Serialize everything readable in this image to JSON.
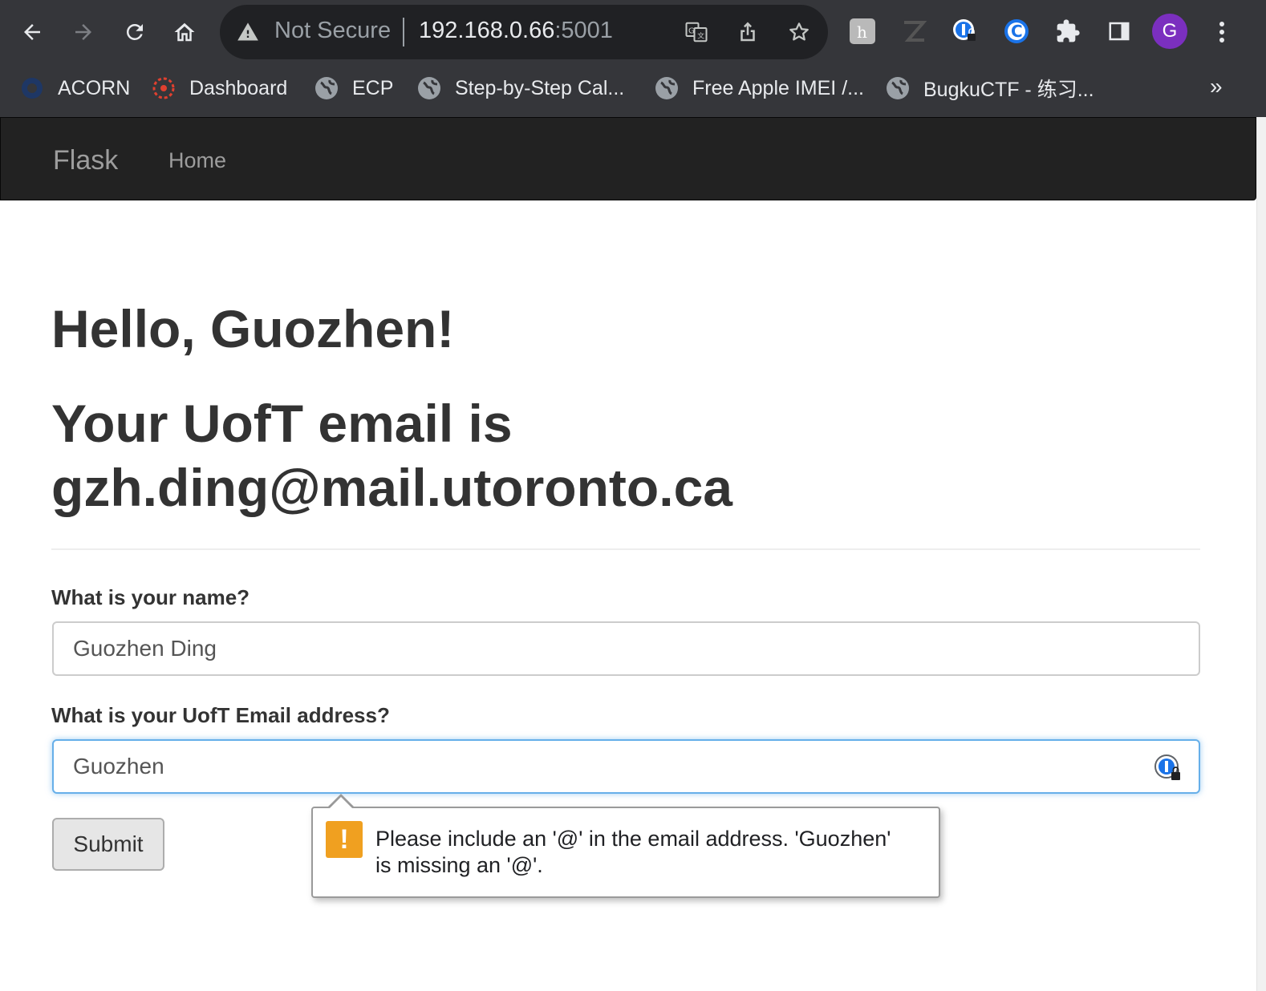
{
  "browser": {
    "omnibox": {
      "security_text": "Not Secure",
      "host": "192.168.0.66",
      "port": ":5001"
    },
    "profile_initial": "G",
    "bookmarks": [
      {
        "label": "ACORN",
        "icon": "acorn-icon"
      },
      {
        "label": "Dashboard",
        "icon": "dashboard-icon"
      },
      {
        "label": "ECP",
        "icon": "globe-icon"
      },
      {
        "label": "Step-by-Step Cal...",
        "icon": "globe-icon"
      },
      {
        "label": "Free Apple IMEI /...",
        "icon": "globe-icon"
      },
      {
        "label": "BugkuCTF - 练习...",
        "icon": "globe-icon"
      }
    ],
    "bookmarks_more": "»",
    "colors": {
      "chrome_bg": "#35363a",
      "omnibox_bg": "#202124",
      "avatar": "#7b2fbf"
    }
  },
  "navbar": {
    "brand": "Flask",
    "links": [
      "Home"
    ]
  },
  "page": {
    "greeting": "Hello, Guozhen!",
    "email_heading_line1": "Your UofT email is",
    "email_heading_line2": "gzh.ding@mail.utoronto.ca"
  },
  "form": {
    "name_label": "What is your name?",
    "name_value": "Guozhen Ding",
    "email_label": "What is your UofT Email address?",
    "email_value": "Guozhen",
    "submit_label": "Submit"
  },
  "validation": {
    "message_line1": "Please include an '@' in the email address. 'Guozhen'",
    "message_line2": "is missing an '@'.",
    "icon": "!",
    "colors": {
      "warning": "#f0a020",
      "focus": "#66afe9"
    }
  }
}
